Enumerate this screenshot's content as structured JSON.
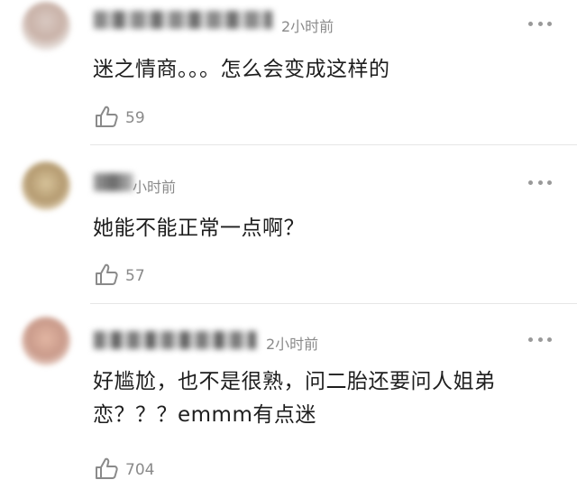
{
  "comments": [
    {
      "time": "2小时前",
      "text": "迷之情商。。。怎么会变成这样的",
      "likes": "59"
    },
    {
      "time": "小时前",
      "text": "她能不能正常一点啊？",
      "likes": "57"
    },
    {
      "time": "2小时前",
      "text_line1": "好尴尬，也不是很熟，问二胎还要问人姐弟",
      "text_line2": "恋？？？emmm有点迷",
      "likes": "704"
    }
  ],
  "colors": {
    "meta_text": "#8a8a8a",
    "body_text": "#1e1e1e",
    "divider": "#e6e6e6"
  },
  "icons": {
    "like": "thumbs-up-outline-icon",
    "more": "more-dots-icon"
  }
}
